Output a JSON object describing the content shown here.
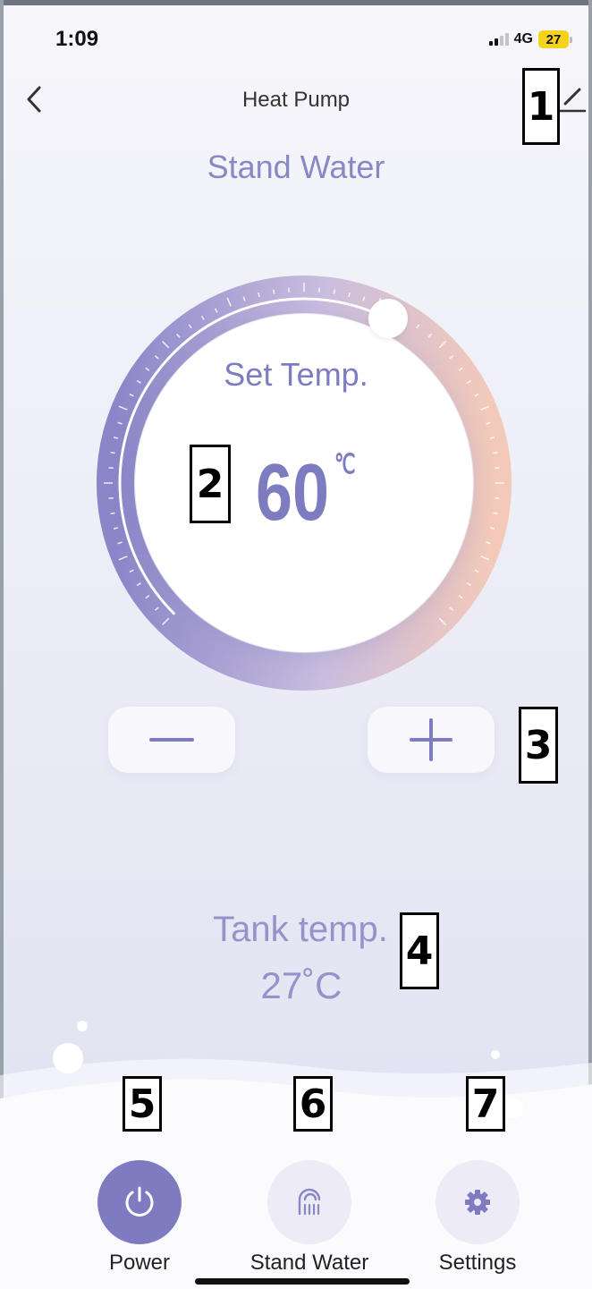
{
  "status_bar": {
    "time": "1:09",
    "network": "4G",
    "battery": "27"
  },
  "header": {
    "title": "Heat Pump",
    "back_icon": "chevron-left-icon",
    "edit_icon": "pencil-icon"
  },
  "mode": {
    "title": "Stand Water"
  },
  "dial": {
    "label": "Set Temp.",
    "value": "60",
    "unit": "℃",
    "level_fraction": 0.6,
    "gradient_colors": [
      "#8b86c8",
      "#c7b8dc",
      "#f3c9b9"
    ]
  },
  "stepper": {
    "minus": "—",
    "plus": "+"
  },
  "tank": {
    "label": "Tank temp.",
    "value": "27˚C"
  },
  "bottom_nav": {
    "items": [
      {
        "label": "Power",
        "icon": "power-icon",
        "active": true
      },
      {
        "label": "Stand Water",
        "icon": "shower-icon",
        "active": false
      },
      {
        "label": "Settings",
        "icon": "gear-icon",
        "active": false
      }
    ]
  },
  "annotations": [
    "1",
    "2",
    "3",
    "4",
    "5",
    "6",
    "7"
  ],
  "colors": {
    "accent": "#7e7bc0",
    "text_accent": "#8a87c4",
    "battery": "#f5d31c"
  }
}
